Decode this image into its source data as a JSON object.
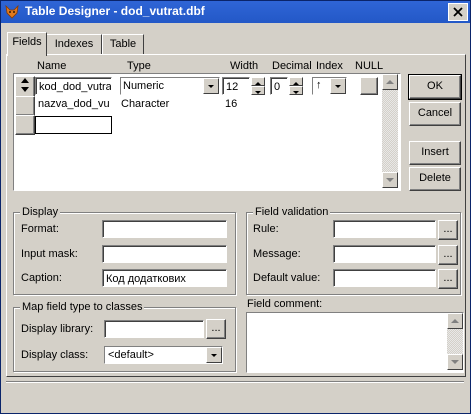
{
  "window": {
    "title": "Table Designer - dod_vutrat.dbf"
  },
  "tabs": [
    {
      "label": "Fields"
    },
    {
      "label": "Indexes"
    },
    {
      "label": "Table"
    }
  ],
  "grid": {
    "headers": {
      "name": "Name",
      "type": "Type",
      "width": "Width",
      "decimal": "Decimal",
      "index": "Index",
      "null": "NULL"
    },
    "rows": [
      {
        "name": "kod_dod_vutra",
        "type": "Numeric",
        "width": "12",
        "decimal": "0",
        "index": "↑"
      },
      {
        "name": "nazva_dod_vu",
        "type": "Character",
        "width": "16",
        "decimal": "",
        "index": ""
      }
    ]
  },
  "buttons": {
    "ok": "OK",
    "cancel": "Cancel",
    "insert": "Insert",
    "delete": "Delete"
  },
  "display": {
    "group_title": "Display",
    "format_label": "Format:",
    "format_value": "",
    "input_mask_label": "Input mask:",
    "input_mask_value": "",
    "caption_label": "Caption:",
    "caption_value": "Код додаткових"
  },
  "validation": {
    "group_title": "Field validation",
    "rule_label": "Rule:",
    "rule_value": "",
    "message_label": "Message:",
    "message_value": "",
    "default_label": "Default value:",
    "default_value": ""
  },
  "map_classes": {
    "group_title": "Map field type to classes",
    "library_label": "Display library:",
    "library_value": "",
    "class_label": "Display class:",
    "class_value": "<default>"
  },
  "comment": {
    "label": "Field comment:",
    "value": ""
  }
}
